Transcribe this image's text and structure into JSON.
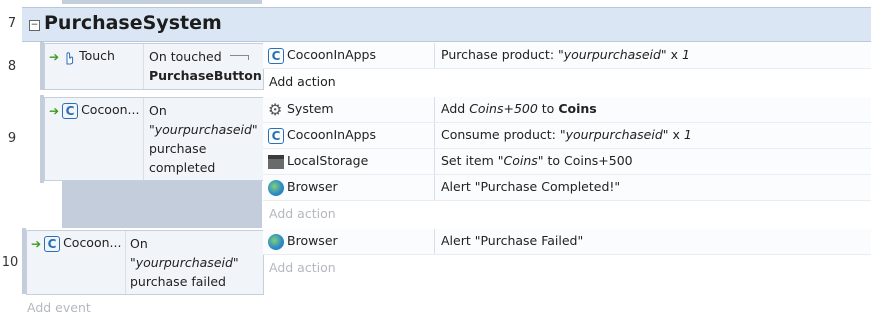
{
  "group": {
    "title": "PurchaseSystem",
    "toggle": "−"
  },
  "line_numbers": [
    "7",
    "8",
    "9",
    "10"
  ],
  "events": [
    {
      "condition": {
        "object": "Touch",
        "text_line1": "On touched",
        "text_line2": "PurchaseButton"
      },
      "actions": [
        {
          "object": "CocoonInApps",
          "text_pre": "Purchase product: ",
          "text_em": "\"yourpurchaseid\"",
          "text_post": " x ",
          "text_em2": "1"
        }
      ],
      "add_action": "Add action"
    },
    {
      "condition": {
        "object": "Cocoon...",
        "line1": "On",
        "line2": "\"yourpurchaseid\"",
        "line3": "purchase",
        "line4": "completed"
      },
      "actions": [
        {
          "object": "System",
          "text_pre": "Add ",
          "text_em": "Coins+500",
          "text_post": " to ",
          "text_strong": "Coins"
        },
        {
          "object": "CocoonInApps",
          "text_pre": "Consume product: ",
          "text_em": "\"yourpurchaseid\"",
          "text_post": " x ",
          "text_em2": "1"
        },
        {
          "object": "LocalStorage",
          "text_pre": "Set item ",
          "text_em": "\"Coins\"",
          "text_post": " to Coins+500"
        },
        {
          "object": "Browser",
          "text": "Alert \"Purchase Completed!\""
        }
      ],
      "add_action": "Add action"
    },
    {
      "condition": {
        "object": "Cocoon...",
        "line1": "On",
        "line2": "\"yourpurchaseid\"",
        "line3": "purchase failed"
      },
      "actions": [
        {
          "object": "Browser",
          "text": "Alert \"Purchase Failed\""
        }
      ],
      "add_action": "Add action"
    }
  ],
  "add_event": "Add event"
}
